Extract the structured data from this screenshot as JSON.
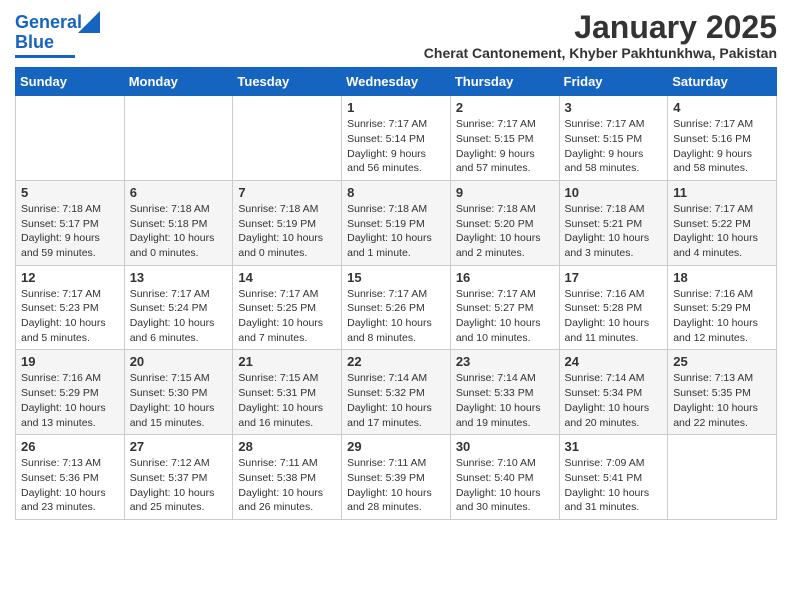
{
  "logo": {
    "general": "General",
    "blue": "Blue"
  },
  "title": "January 2025",
  "subtitle": "Cherat Cantonement, Khyber Pakhtunkhwa, Pakistan",
  "weekdays": [
    "Sunday",
    "Monday",
    "Tuesday",
    "Wednesday",
    "Thursday",
    "Friday",
    "Saturday"
  ],
  "weeks": [
    [
      {
        "day": "",
        "info": ""
      },
      {
        "day": "",
        "info": ""
      },
      {
        "day": "",
        "info": ""
      },
      {
        "day": "1",
        "info": "Sunrise: 7:17 AM\nSunset: 5:14 PM\nDaylight: 9 hours\nand 56 minutes."
      },
      {
        "day": "2",
        "info": "Sunrise: 7:17 AM\nSunset: 5:15 PM\nDaylight: 9 hours\nand 57 minutes."
      },
      {
        "day": "3",
        "info": "Sunrise: 7:17 AM\nSunset: 5:15 PM\nDaylight: 9 hours\nand 58 minutes."
      },
      {
        "day": "4",
        "info": "Sunrise: 7:17 AM\nSunset: 5:16 PM\nDaylight: 9 hours\nand 58 minutes."
      }
    ],
    [
      {
        "day": "5",
        "info": "Sunrise: 7:18 AM\nSunset: 5:17 PM\nDaylight: 9 hours\nand 59 minutes."
      },
      {
        "day": "6",
        "info": "Sunrise: 7:18 AM\nSunset: 5:18 PM\nDaylight: 10 hours\nand 0 minutes."
      },
      {
        "day": "7",
        "info": "Sunrise: 7:18 AM\nSunset: 5:19 PM\nDaylight: 10 hours\nand 0 minutes."
      },
      {
        "day": "8",
        "info": "Sunrise: 7:18 AM\nSunset: 5:19 PM\nDaylight: 10 hours\nand 1 minute."
      },
      {
        "day": "9",
        "info": "Sunrise: 7:18 AM\nSunset: 5:20 PM\nDaylight: 10 hours\nand 2 minutes."
      },
      {
        "day": "10",
        "info": "Sunrise: 7:18 AM\nSunset: 5:21 PM\nDaylight: 10 hours\nand 3 minutes."
      },
      {
        "day": "11",
        "info": "Sunrise: 7:17 AM\nSunset: 5:22 PM\nDaylight: 10 hours\nand 4 minutes."
      }
    ],
    [
      {
        "day": "12",
        "info": "Sunrise: 7:17 AM\nSunset: 5:23 PM\nDaylight: 10 hours\nand 5 minutes."
      },
      {
        "day": "13",
        "info": "Sunrise: 7:17 AM\nSunset: 5:24 PM\nDaylight: 10 hours\nand 6 minutes."
      },
      {
        "day": "14",
        "info": "Sunrise: 7:17 AM\nSunset: 5:25 PM\nDaylight: 10 hours\nand 7 minutes."
      },
      {
        "day": "15",
        "info": "Sunrise: 7:17 AM\nSunset: 5:26 PM\nDaylight: 10 hours\nand 8 minutes."
      },
      {
        "day": "16",
        "info": "Sunrise: 7:17 AM\nSunset: 5:27 PM\nDaylight: 10 hours\nand 10 minutes."
      },
      {
        "day": "17",
        "info": "Sunrise: 7:16 AM\nSunset: 5:28 PM\nDaylight: 10 hours\nand 11 minutes."
      },
      {
        "day": "18",
        "info": "Sunrise: 7:16 AM\nSunset: 5:29 PM\nDaylight: 10 hours\nand 12 minutes."
      }
    ],
    [
      {
        "day": "19",
        "info": "Sunrise: 7:16 AM\nSunset: 5:29 PM\nDaylight: 10 hours\nand 13 minutes."
      },
      {
        "day": "20",
        "info": "Sunrise: 7:15 AM\nSunset: 5:30 PM\nDaylight: 10 hours\nand 15 minutes."
      },
      {
        "day": "21",
        "info": "Sunrise: 7:15 AM\nSunset: 5:31 PM\nDaylight: 10 hours\nand 16 minutes."
      },
      {
        "day": "22",
        "info": "Sunrise: 7:14 AM\nSunset: 5:32 PM\nDaylight: 10 hours\nand 17 minutes."
      },
      {
        "day": "23",
        "info": "Sunrise: 7:14 AM\nSunset: 5:33 PM\nDaylight: 10 hours\nand 19 minutes."
      },
      {
        "day": "24",
        "info": "Sunrise: 7:14 AM\nSunset: 5:34 PM\nDaylight: 10 hours\nand 20 minutes."
      },
      {
        "day": "25",
        "info": "Sunrise: 7:13 AM\nSunset: 5:35 PM\nDaylight: 10 hours\nand 22 minutes."
      }
    ],
    [
      {
        "day": "26",
        "info": "Sunrise: 7:13 AM\nSunset: 5:36 PM\nDaylight: 10 hours\nand 23 minutes."
      },
      {
        "day": "27",
        "info": "Sunrise: 7:12 AM\nSunset: 5:37 PM\nDaylight: 10 hours\nand 25 minutes."
      },
      {
        "day": "28",
        "info": "Sunrise: 7:11 AM\nSunset: 5:38 PM\nDaylight: 10 hours\nand 26 minutes."
      },
      {
        "day": "29",
        "info": "Sunrise: 7:11 AM\nSunset: 5:39 PM\nDaylight: 10 hours\nand 28 minutes."
      },
      {
        "day": "30",
        "info": "Sunrise: 7:10 AM\nSunset: 5:40 PM\nDaylight: 10 hours\nand 30 minutes."
      },
      {
        "day": "31",
        "info": "Sunrise: 7:09 AM\nSunset: 5:41 PM\nDaylight: 10 hours\nand 31 minutes."
      },
      {
        "day": "",
        "info": ""
      }
    ]
  ]
}
